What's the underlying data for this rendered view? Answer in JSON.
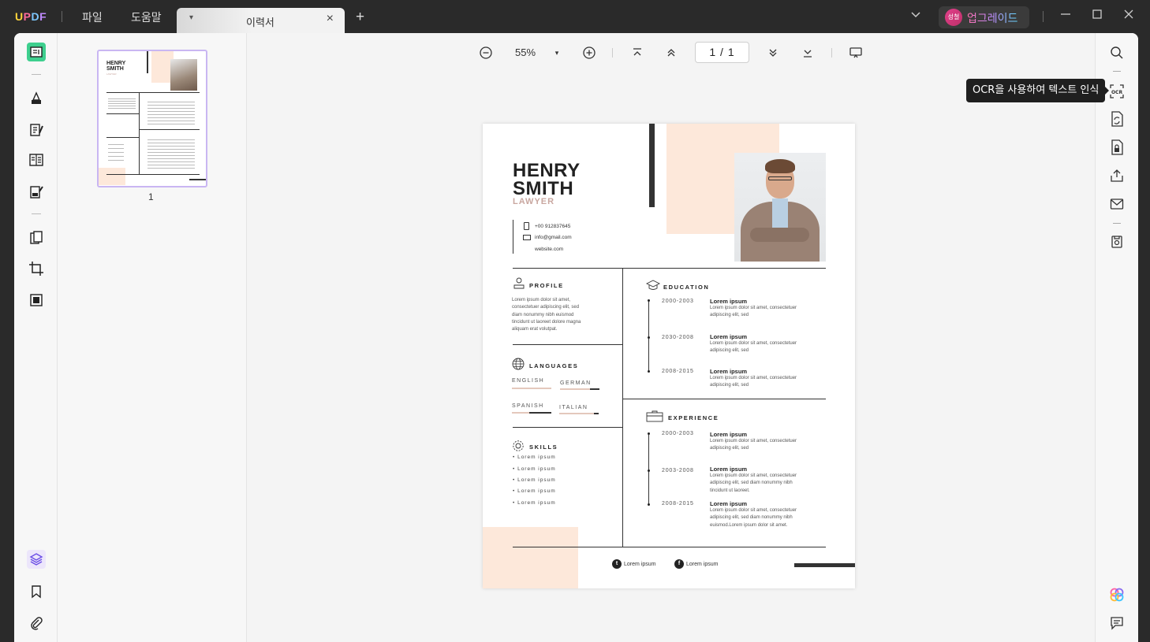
{
  "titlebar": {
    "logo": "UPDF",
    "menu": [
      "파일",
      "도움말"
    ],
    "tab_title": "이력서",
    "upgrade_avatar": "성철",
    "upgrade_label": "업그레이드"
  },
  "toolbar": {
    "zoom": "55%",
    "page_current": "1",
    "page_total": "1"
  },
  "thumbnail": {
    "page_number": "1"
  },
  "tooltip": "OCR을 사용하여 텍스트 인식",
  "resume": {
    "first_name": "HENRY",
    "last_name": "SMITH",
    "role": "LAWYER",
    "phone": "+00 912837645",
    "email": "info@gmail.com",
    "website": "website.com",
    "profile": {
      "title": "PROFILE",
      "lines": [
        "Lorem ipsum dolor sit amet,",
        "consectetuer adipiscing elit, sed",
        "diam nonummy nibh euismod",
        "tincidunt ut laoreet dolore magna",
        "aliquam erat volutpat."
      ]
    },
    "languages": {
      "title": "LANGUAGES",
      "items": [
        "ENGLISH",
        "GERMAN",
        "SPANISH",
        "ITALIAN"
      ]
    },
    "skills": {
      "title": "SKILLS",
      "items": [
        "• Lorem ipsum",
        "• Lorem ipsum",
        "• Lorem ipsum",
        "• Lorem ipsum",
        "• Lorem ipsum"
      ]
    },
    "education": {
      "title": "EDUCATION",
      "items": [
        {
          "years": "2000-2003",
          "title": "Lorem ipsum",
          "l1": "Lorem ipsum dolor sit amet, consectetuer",
          "l2": "adipiscing elit, sed",
          "l3": ""
        },
        {
          "years": "2030-2008",
          "title": "Lorem ipsum",
          "l1": "Lorem ipsum dolor sit amet, consectetuer",
          "l2": "adipiscing elit, sed",
          "l3": ""
        },
        {
          "years": "2008-2015",
          "title": "Lorem ipsum",
          "l1": "Lorem ipsum dolor sit amet, consectetuer",
          "l2": "adipiscing elit, sed",
          "l3": ""
        }
      ]
    },
    "experience": {
      "title": "EXPERIENCE",
      "items": [
        {
          "years": "2000-2003",
          "title": "Lorem ipsum",
          "l1": "Lorem ipsum dolor sit amet, consectetuer",
          "l2": "adipiscing elit, sed",
          "l3": ""
        },
        {
          "years": "2003-2008",
          "title": "Lorem ipsum",
          "l1": "Lorem ipsum dolor sit amet, consectetuer",
          "l2": "adipiscing elit, sed diam nonummy nibh",
          "l3": "tincidunt ut laoreet."
        },
        {
          "years": "2008-2015",
          "title": "Lorem ipsum",
          "l1": "Lorem ipsum dolor sit amet, consectetuer",
          "l2": "adipiscing elit, sed diam nonummy nibh",
          "l3": "euismod.Lorem ipsum dolor sit amet."
        }
      ]
    },
    "social": {
      "twitter": "Lorem ipsum",
      "facebook": "Lorem ipsum"
    }
  },
  "colors": {
    "accent_peach": "#fde8da",
    "selection": "#c9b6f2",
    "role": "#c9a7a0"
  }
}
